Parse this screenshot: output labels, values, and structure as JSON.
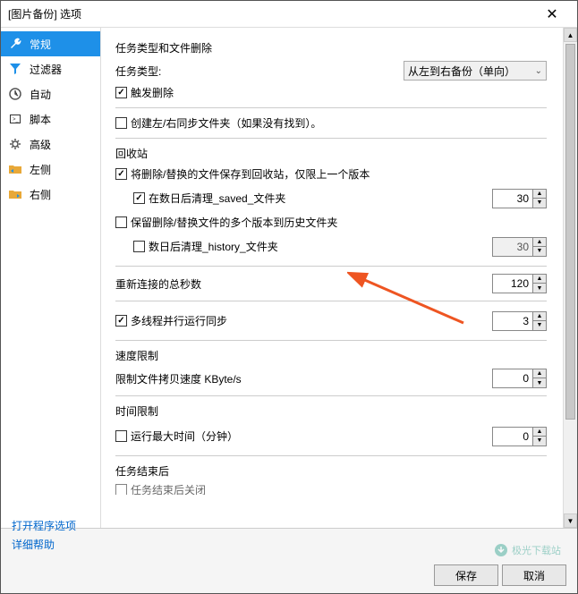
{
  "titlebar": {
    "text": "[图片备份] 选项"
  },
  "sidebar": {
    "items": [
      {
        "label": "常规"
      },
      {
        "label": "过滤器"
      },
      {
        "label": "自动"
      },
      {
        "label": "脚本"
      },
      {
        "label": "高级"
      },
      {
        "label": "左侧"
      },
      {
        "label": "右侧"
      }
    ]
  },
  "main": {
    "section1_title": "任务类型和文件删除",
    "task_type_label": "任务类型:",
    "task_type_value": "从左到右备份（单向）",
    "trigger_delete": "触发删除",
    "create_folders": "创建左/右同步文件夹（如果没有找到）。",
    "recycle_title": "回收站",
    "save_deleted": "将删除/替换的文件保存到回收站，仅限上一个版本",
    "clean_saved": "在数日后清理_saved_文件夹",
    "clean_saved_days": "30",
    "keep_versions": "保留删除/替换文件的多个版本到历史文件夹",
    "clean_history": "数日后清理_history_文件夹",
    "clean_history_days": "30",
    "reconnect_label": "重新连接的总秒数",
    "reconnect_value": "120",
    "multithread": "多线程并行运行同步",
    "multithread_value": "3",
    "speed_limit_title": "速度限制",
    "speed_limit_label": "限制文件拷贝速度 KByte/s",
    "speed_limit_value": "0",
    "time_limit_title": "时间限制",
    "time_limit_label": "运行最大时间（分钟）",
    "time_limit_value": "0",
    "end_title": "任务结束后",
    "end_close": "任务结束后关闭"
  },
  "footer": {
    "link1": "打开程序选项",
    "link2": "详细帮助",
    "save": "保存",
    "cancel": "取消"
  },
  "watermark": "极光下载站"
}
